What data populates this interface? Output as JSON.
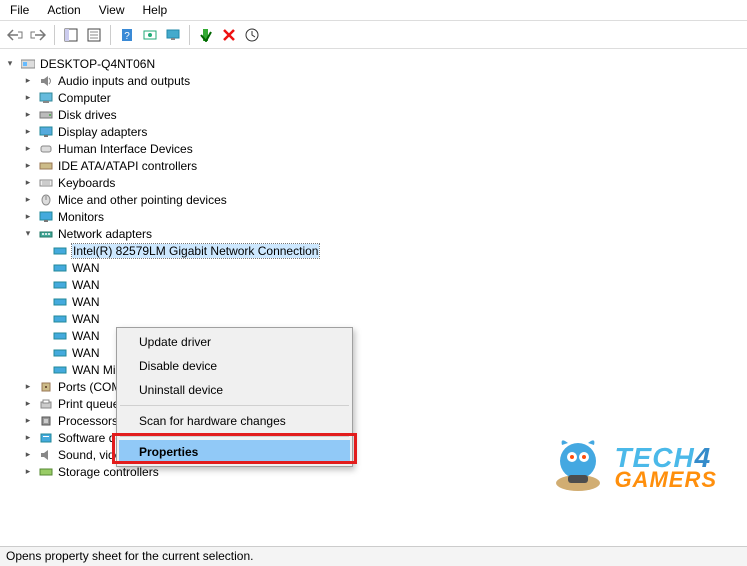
{
  "menu": {
    "file": "File",
    "action": "Action",
    "view": "View",
    "help": "Help"
  },
  "root": {
    "label": "DESKTOP-Q4NT06N"
  },
  "cats": {
    "audio": "Audio inputs and outputs",
    "computer": "Computer",
    "disk": "Disk drives",
    "display": "Display adapters",
    "hid": "Human Interface Devices",
    "ide": "IDE ATA/ATAPI controllers",
    "keyboards": "Keyboards",
    "mice": "Mice and other pointing devices",
    "monitors": "Monitors",
    "network": "Network adapters",
    "ports": "Ports (COM & LPT)",
    "printq": "Print queues",
    "processors": "Processors",
    "software": "Software devices",
    "sound": "Sound, video and game controllers",
    "storage": "Storage controllers"
  },
  "net": {
    "intel": "Intel(R) 82579LM Gigabit Network Connection",
    "w0": "WAN",
    "w1": "WAN",
    "w2": "WAN",
    "w3": "WAN",
    "w4": "WAN",
    "w5": "WAN",
    "sstp": "WAN Miniport (SSTP)"
  },
  "ctx": {
    "update": "Update driver",
    "disable": "Disable device",
    "uninstall": "Uninstall device",
    "scan": "Scan for hardware changes",
    "props": "Properties"
  },
  "status": "Opens property sheet for the current selection.",
  "wm": {
    "tech": "TECH",
    "four": "4",
    "gamers": "GAMERS"
  }
}
